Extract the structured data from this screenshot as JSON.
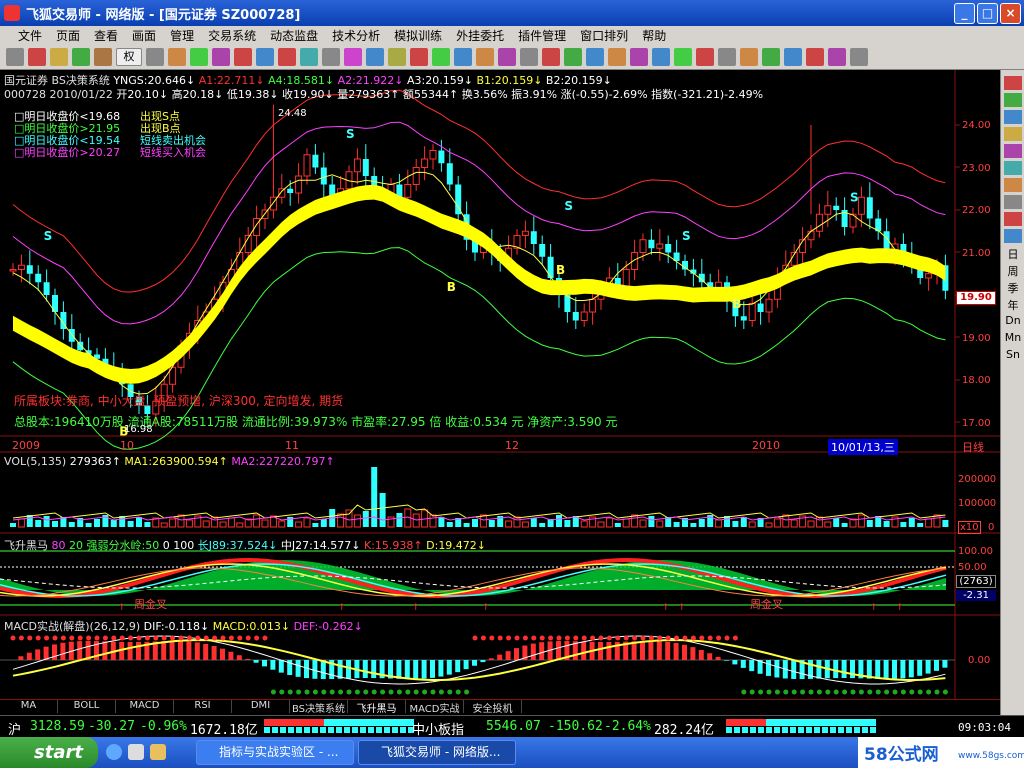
{
  "window": {
    "title": "飞狐交易师 - 网络版 - [国元证券 SZ000728]",
    "btn_min": "_",
    "btn_max": "□",
    "btn_close": "×"
  },
  "menu": [
    "文件",
    "页面",
    "查看",
    "画面",
    "管理",
    "交易系统",
    "动态监盘",
    "技术分析",
    "模拟训练",
    "外挂委托",
    "插件管理",
    "窗口排列",
    "帮助"
  ],
  "toolbar": {
    "quan_label": "权"
  },
  "header": {
    "line1": [
      {
        "text": "国元证券 BS决策系统 ",
        "color": "#e0e0e0"
      },
      {
        "text": "YNGS:20.646↓",
        "color": "#ffffff"
      },
      {
        "text": " A1:22.711↓",
        "color": "#ff3030"
      },
      {
        "text": " A4:18.581↓",
        "color": "#40ff40"
      },
      {
        "text": " A2:21.922↓",
        "color": "#ff40ff"
      },
      {
        "text": " A3:20.159↓",
        "color": "#ffffff"
      },
      {
        "text": " B1:20.159↓",
        "color": "#ffff40"
      },
      {
        "text": " B2:20.159↓",
        "color": "#ffffff"
      }
    ],
    "line2": [
      {
        "text": "000728 2010/01/22 ",
        "color": "#e0e0e0"
      },
      {
        "text": "开20.10↓",
        "color": "#ffffff"
      },
      {
        "text": " 高20.18↓",
        "color": "#ffffff"
      },
      {
        "text": " 低19.38↓",
        "color": "#ffffff"
      },
      {
        "text": " 收19.90↓",
        "color": "#ffffff"
      },
      {
        "text": " 量279363↑",
        "color": "#ffffff"
      },
      {
        "text": " 额55344↑",
        "color": "#ffffff"
      },
      {
        "text": " 换3.56%",
        "color": "#ffffff"
      },
      {
        "text": " 振3.91%",
        "color": "#ffffff"
      },
      {
        "text": " 涨(-0.55)-2.69%",
        "color": "#ffffff"
      },
      {
        "text": " 指数(-321.21)-2.49%",
        "color": "#ffffff"
      }
    ]
  },
  "legend": [
    {
      "text": "□明日收盘价<19.68",
      "color": "#ffffff",
      "sig": "出现S点",
      "sig_color": "#ffff40"
    },
    {
      "text": "□明日收盘价>21.95",
      "color": "#40ff40",
      "sig": "出现B点",
      "sig_color": "#ffff40"
    },
    {
      "text": "□明日收盘价<19.54",
      "color": "#40ffff",
      "sig": "短线卖出机会",
      "sig_color": "#40ffff"
    },
    {
      "text": "□明日收盘价>20.27",
      "color": "#ff40ff",
      "sig": "短线买入机会",
      "sig_color": "#ff40ff"
    }
  ],
  "info": {
    "sector": "所属板块:券商, 中小大盘, 预盈预增, 沪深300, 定向增发, 期货",
    "fund": "总股本:196410万股  流通A股:78511万股  流通比例:39.973%  市盈率:27.95 倍  收益:0.534 元  净资产:3.590 元",
    "high_label": "24.48",
    "low_label": "16.98"
  },
  "price_axis": {
    "ticks": [
      "24.00",
      "23.00",
      "22.00",
      "21.00",
      "20.00",
      "19.00",
      "18.00",
      "17.00"
    ],
    "current": "19.90"
  },
  "date_axis": {
    "labels": [
      "2009",
      "10",
      "11",
      "12",
      "2010"
    ],
    "cursor": "10/01/13,三",
    "period": "日线"
  },
  "vol_panel": {
    "title": [
      {
        "text": "VOL(5,135) ",
        "color": "#e0e0e0"
      },
      {
        "text": "279363↑",
        "color": "#ffffff"
      },
      {
        "text": " MA1:263900.594↑",
        "color": "#ffff40"
      },
      {
        "text": " MA2:227220.797↑",
        "color": "#ff40ff"
      }
    ],
    "ticks": [
      "200000",
      "100000",
      "0"
    ],
    "unit": "x10"
  },
  "fs_panel": {
    "title": [
      {
        "text": "飞升黑马 ",
        "color": "#e0e0e0"
      },
      {
        "text": "80 ",
        "color": "#ff40ff"
      },
      {
        "text": "20 ",
        "color": "#40ff40"
      },
      {
        "text": "强弱分水岭:50 ",
        "color": "#40ff40"
      },
      {
        "text": "0 ",
        "color": "#ffffff"
      },
      {
        "text": "100 ",
        "color": "#ffffff"
      },
      {
        "text": "长J89:37.524↓",
        "color": "#40ffff"
      },
      {
        "text": " 中J27:14.577↓",
        "color": "#ffffff"
      },
      {
        "text": " K:15.938↑",
        "color": "#ff4040"
      },
      {
        "text": " D:19.472↓",
        "color": "#ffff40"
      }
    ],
    "ticks": [
      "100.00",
      "50.00"
    ],
    "box": "(2763)",
    "box_val": "-2.31",
    "annot": "周金叉"
  },
  "macd_panel": {
    "title": [
      {
        "text": "MACD实战(解盘)(26,12,9) ",
        "color": "#e0e0e0"
      },
      {
        "text": "DIF:-0.118↓",
        "color": "#ffffff"
      },
      {
        "text": " MACD:0.013↓",
        "color": "#ffff40"
      },
      {
        "text": " DEF:-0.262↓",
        "color": "#ff40ff"
      }
    ],
    "ticks": [
      "0.00"
    ]
  },
  "bottom_tabs": [
    "MA",
    "BOLL",
    "MACD",
    "RSI",
    "DMI",
    "BS决策系统",
    "飞升黑马",
    "MACD实战",
    "安全投机"
  ],
  "active_tab_index": 6,
  "side_tabs": [
    "日",
    "周",
    "季",
    "年",
    "Dn",
    "Mn",
    "Sn"
  ],
  "status": {
    "sh_label": "沪",
    "sh_val": "3128.59",
    "sh_chg": "-30.27",
    "sh_pct": "-0.96%",
    "sh_amt": "1672.18亿",
    "zx_label": "中小板指",
    "zx_val": "5546.07",
    "zx_chg": "-150.62",
    "zx_pct": "-2.64%",
    "zx_amt": "282.24亿",
    "time": "09:03:04"
  },
  "taskbar": {
    "start": "start",
    "tasks": [
      {
        "label": "指标与实战实验区 - ..."
      },
      {
        "label": "飞狐交易师 - 网络版..."
      }
    ],
    "logo": "58公式网",
    "logo_url": "www.58gs.com"
  },
  "colors": {
    "up": "#ff3030",
    "down": "#30ffff",
    "axis": "#8a1010",
    "accent": "#ffff00"
  }
}
